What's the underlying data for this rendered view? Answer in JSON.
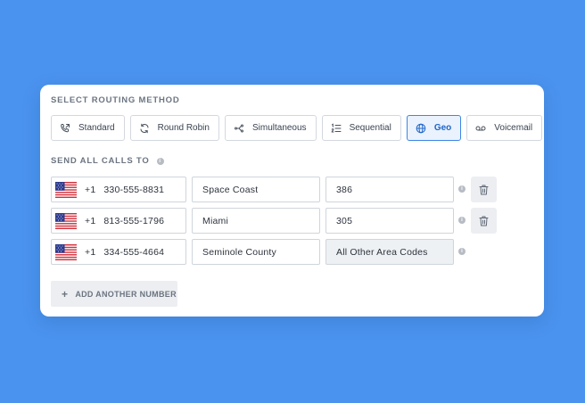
{
  "routing": {
    "title": "SELECT ROUTING METHOD",
    "methods": [
      {
        "label": "Standard",
        "icon": "phone-forward-icon",
        "active": false
      },
      {
        "label": "Round Robin",
        "icon": "refresh-icon",
        "active": false
      },
      {
        "label": "Simultaneous",
        "icon": "share-nodes-icon",
        "active": false
      },
      {
        "label": "Sequential",
        "icon": "numbered-list-icon",
        "active": false
      },
      {
        "label": "Geo",
        "icon": "globe-icon",
        "active": true
      },
      {
        "label": "Voicemail",
        "icon": "voicemail-icon",
        "active": false
      }
    ],
    "active_color": "#3d86e8"
  },
  "send": {
    "title": "SEND ALL CALLS TO",
    "info_icon": "i"
  },
  "rows": [
    {
      "country_code": "+1",
      "phone": "330-555-8831",
      "name": "Space Coast",
      "area_code": "386",
      "deletable": true
    },
    {
      "country_code": "+1",
      "phone": "813-555-1796",
      "name": "Miami",
      "area_code": "305",
      "deletable": true
    },
    {
      "country_code": "+1",
      "phone": "334-555-4664",
      "name": "Seminole County",
      "area_code": "All Other Area Codes",
      "deletable": false
    }
  ],
  "add_button": {
    "plus": "+",
    "label": "ADD ANOTHER NUMBER"
  },
  "colors": {
    "background": "#4a93ee",
    "card": "#ffffff",
    "accent": "#1f66c9"
  }
}
